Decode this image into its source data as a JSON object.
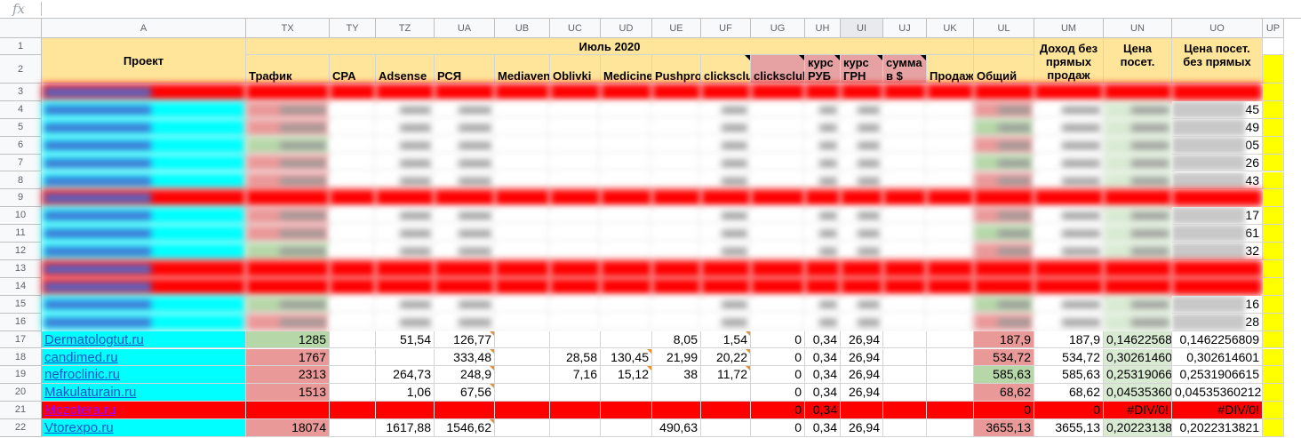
{
  "formula_bar": {
    "icon_label": "fx",
    "value": ""
  },
  "columns": [
    "A",
    "TX",
    "TY",
    "TZ",
    "UA",
    "UB",
    "UC",
    "UD",
    "UE",
    "UF",
    "UG",
    "UH",
    "UI",
    "UJ",
    "UK",
    "UL",
    "UM",
    "UN",
    "UO",
    "UP"
  ],
  "selected_columns": [
    "UI"
  ],
  "colors": {
    "red": "#ff0000",
    "cyan": "#00ffff",
    "green": "#b6d7a8",
    "pink": "#ea9999",
    "header_yellow": "#ffe599",
    "salmon": "#e6a2a2",
    "yellow": "#ffff00",
    "light_green": "#d9ead3"
  },
  "header": {
    "month_label": "Июль 2020",
    "project_label": "Проект",
    "labels": {
      "TX": "Трафик",
      "TY": "CPA",
      "TZ": "Adsense",
      "UA": "РСЯ",
      "UB": "Mediavenus",
      "UC": "Oblivki",
      "UD": "Medicinetoday",
      "UE": "Pushprofit",
      "UF": "clicksclub",
      "UG": "clicksclub",
      "UH": "курс РУБ",
      "UI": "курс ГРН",
      "UJ": "сумма в $",
      "UK": "Продажи",
      "UL": "Общий",
      "UM": "Доход без прямых продаж",
      "UN": "Цена посет.",
      "UO": "Цена посет. без прямых"
    }
  },
  "rows": [
    {
      "num": "3",
      "type": "red",
      "project": "",
      "partial": {}
    },
    {
      "num": "4",
      "type": "cyan-blur",
      "partial": {
        "UO": "45"
      }
    },
    {
      "num": "5",
      "type": "cyan-blur",
      "partial": {
        "UO": "49"
      }
    },
    {
      "num": "6",
      "type": "cyan-blur",
      "partial": {
        "UO": "05"
      }
    },
    {
      "num": "7",
      "type": "cyan-blur",
      "partial": {
        "UO": "26"
      }
    },
    {
      "num": "8",
      "type": "cyan-blur",
      "partial": {
        "UO": "43"
      }
    },
    {
      "num": "9",
      "type": "red",
      "partial": {}
    },
    {
      "num": "10",
      "type": "cyan-blur",
      "partial": {
        "UO": "17"
      }
    },
    {
      "num": "11",
      "type": "cyan-blur",
      "partial": {
        "UO": "61"
      }
    },
    {
      "num": "12",
      "type": "cyan-blur",
      "partial": {
        "UO": "32"
      }
    },
    {
      "num": "13",
      "type": "red",
      "partial": {}
    },
    {
      "num": "14",
      "type": "red",
      "partial": {}
    },
    {
      "num": "15",
      "type": "cyan-blur",
      "partial": {
        "UO": "16"
      }
    },
    {
      "num": "16",
      "type": "cyan-blur",
      "partial": {
        "UO": "28"
      }
    },
    {
      "num": "17",
      "type": "cyan",
      "project": "Dermatologtut.ru",
      "values": {
        "TX": "1285",
        "TZ": "51,54",
        "UA": "126,77",
        "UE": "8,05",
        "UF": "1,54",
        "UG": "0",
        "UH": "0,34",
        "UI": "26,94",
        "UL": "187,9",
        "UM": "187,9",
        "UN": "0,146225680",
        "UO": "0,1462256809"
      },
      "fills": {
        "TX": "green",
        "UL": "pink",
        "UN": "light_green"
      }
    },
    {
      "num": "18",
      "type": "cyan",
      "project": " candimed.ru",
      "values": {
        "TX": "1767",
        "UA": "333,48",
        "UC": "28,58",
        "UD": "130,45",
        "UE": "21,99",
        "UF": "20,22",
        "UG": "0",
        "UH": "0,34",
        "UI": "26,94",
        "UL": "534,72",
        "UM": "534,72",
        "UN": "0,302614601",
        "UO": "0,302614601"
      },
      "fills": {
        "TX": "pink",
        "UL": "pink",
        "UN": "light_green"
      }
    },
    {
      "num": "19",
      "type": "cyan",
      "project": " nefroclinic.ru",
      "values": {
        "TX": "2313",
        "TZ": "264,73",
        "UA": "248,9",
        "UC": "7,16",
        "UD": "15,12",
        "UE": "38",
        "UF": "11,72",
        "UG": "0",
        "UH": "0,34",
        "UI": "26,94",
        "UL": "585,63",
        "UM": "585,63",
        "UN": "0,253190661",
        "UO": "0,2531906615"
      },
      "fills": {
        "TX": "pink",
        "UL": "green",
        "UN": "light_green"
      }
    },
    {
      "num": "20",
      "type": "cyan",
      "project": "Makulaturain.ru",
      "values": {
        "TX": "1513",
        "TZ": "1,06",
        "UA": "67,56",
        "UG": "0",
        "UH": "0,34",
        "UI": "26,94",
        "UL": "68,62",
        "UM": "68,62",
        "UN": "0,045353602",
        "UO": "0,04535360212"
      },
      "fills": {
        "TX": "pink",
        "UL": "pink",
        "UN": "light_green"
      }
    },
    {
      "num": "21",
      "type": "red",
      "project": "Mozotera.ru",
      "values": {
        "UG": "0",
        "UH": "0,34",
        "UL": "0",
        "UM": "0",
        "UN": "#DIV/0!",
        "UO": "#DIV/0!"
      },
      "fills": {}
    },
    {
      "num": "22",
      "type": "cyan",
      "project": "Vtorexpo.ru",
      "values": {
        "TX": "18074",
        "TZ": "1617,88",
        "UA": "1546,62",
        "UE": "490,63",
        "UG": "0",
        "UH": "0,34",
        "UI": "26,94",
        "UL": "3655,13",
        "UM": "3655,13",
        "UN": "0,202231382",
        "UO": "0,2022313821"
      },
      "fills": {
        "TX": "pink",
        "UL": "pink",
        "UN": "light_green"
      }
    }
  ]
}
